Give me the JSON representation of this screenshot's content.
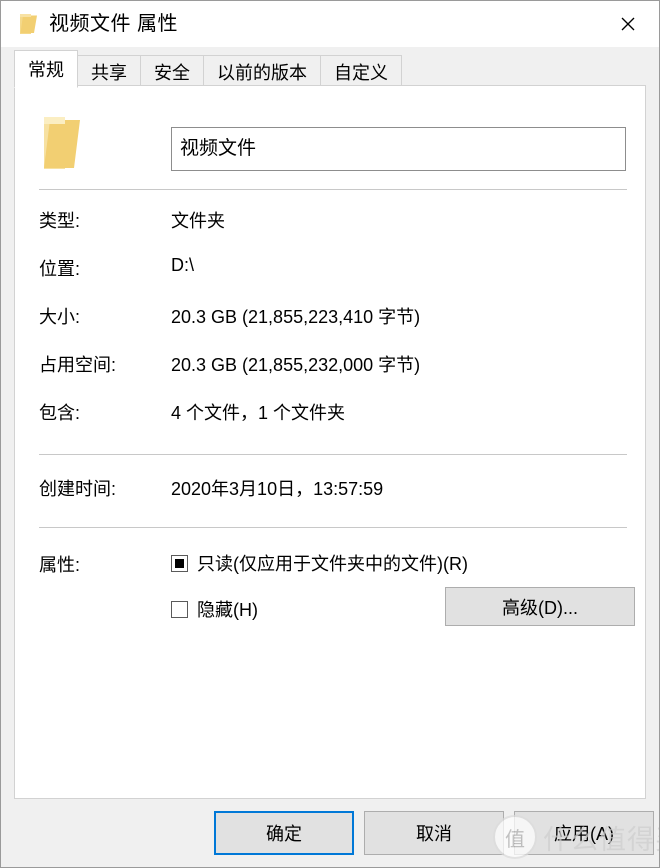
{
  "window": {
    "title": "视频文件 属性",
    "icon": "folder-icon",
    "close_label": "✕"
  },
  "tabs": [
    {
      "label": "常规",
      "active": true
    },
    {
      "label": "共享",
      "active": false
    },
    {
      "label": "安全",
      "active": false
    },
    {
      "label": "以前的版本",
      "active": false
    },
    {
      "label": "自定义",
      "active": false
    }
  ],
  "general": {
    "folder_icon": "folder-icon",
    "name_value": "视频文件",
    "name_placeholder": "视频文件",
    "properties": [
      {
        "label": "类型:",
        "value": "文件夹"
      },
      {
        "label": "位置:",
        "value": "D:\\"
      },
      {
        "label": "大小:",
        "value": "20.3 GB (21,855,223,410 字节)"
      },
      {
        "label": "占用空间:",
        "value": "20.3 GB (21,855,232,000 字节)"
      },
      {
        "label": "包含:",
        "value": "4 个文件，1 个文件夹"
      }
    ],
    "created": {
      "label": "创建时间:",
      "value": "2020年3月10日，13:57:59"
    },
    "attributes": {
      "label": "属性:",
      "readonly": {
        "text": "只读(仅应用于文件夹中的文件)(R)",
        "state": "indeterminate"
      },
      "hidden": {
        "text": "隐藏(H)",
        "state": "unchecked"
      },
      "advanced_button": "高级(D)..."
    }
  },
  "footer": {
    "ok": "确定",
    "cancel": "取消",
    "apply": "应用(A)"
  },
  "watermark": {
    "logo": "值",
    "text": "什么值得买"
  },
  "colors": {
    "accent": "#0078d7",
    "folder": "#f2d07f",
    "panel_bg": "#ffffff",
    "dialog_bg": "#f0f0f0",
    "button_bg": "#e1e1e1"
  }
}
